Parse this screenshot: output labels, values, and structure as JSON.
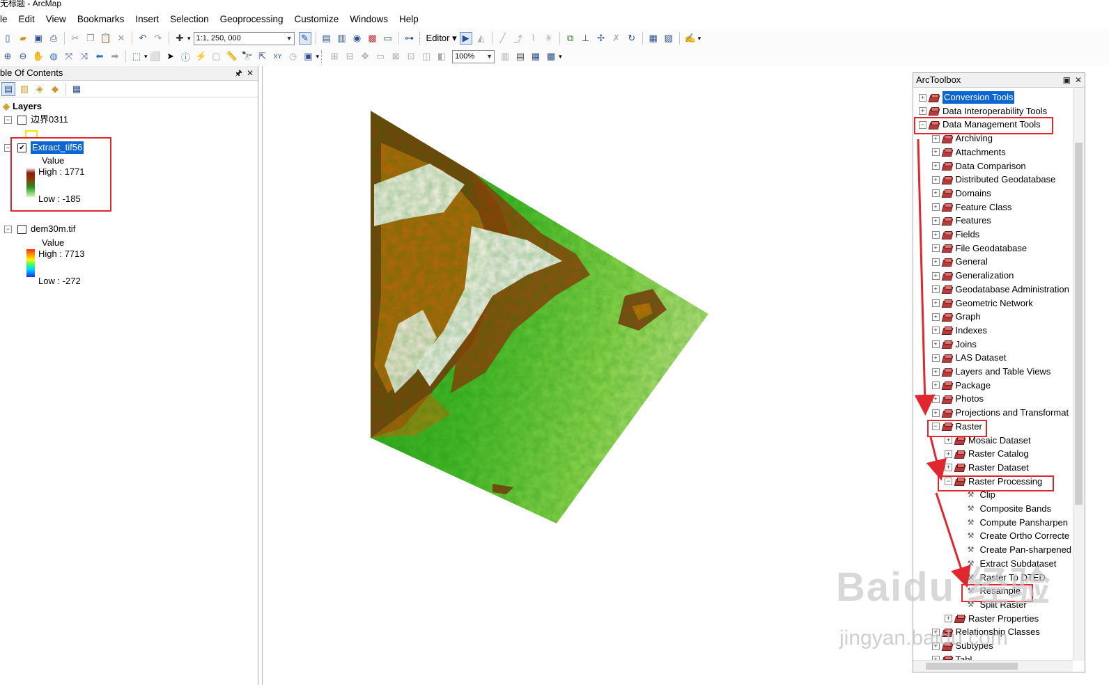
{
  "window": {
    "title": "无标题 - ArcMap"
  },
  "menu": [
    "le",
    "Edit",
    "View",
    "Bookmarks",
    "Insert",
    "Selection",
    "Geoprocessing",
    "Customize",
    "Windows",
    "Help"
  ],
  "toolbar": {
    "scale": "1:1, 250, 000",
    "editor_label": "Editor",
    "zoom": "100%"
  },
  "toc": {
    "title": "ble Of Contents",
    "pin": "◉",
    "close": "✕",
    "layers_label": "Layers",
    "layers": [
      {
        "name": "边界0311",
        "checked": false,
        "expander": "−"
      },
      {
        "name": "Extract_tif56",
        "checked": true,
        "expander": "−",
        "value_label": "Value",
        "high": "High : 1771",
        "low": "Low : -185"
      },
      {
        "name": "dem30m.tif",
        "checked": false,
        "expander": "−",
        "value_label": "Value",
        "high": "High : 7713",
        "low": "Low : -272"
      }
    ]
  },
  "arctoolbox": {
    "title": "ArcToolbox",
    "items": [
      {
        "label": "Conversion Tools",
        "level": 0,
        "expander": "+",
        "kind": "toolbox",
        "selected": true
      },
      {
        "label": "Data Interoperability Tools",
        "level": 0,
        "expander": "+",
        "kind": "toolbox"
      },
      {
        "label": "Data Management Tools",
        "level": 0,
        "expander": "−",
        "kind": "toolbox"
      },
      {
        "label": "Archiving",
        "level": 1,
        "expander": "+",
        "kind": "toolbox"
      },
      {
        "label": "Attachments",
        "level": 1,
        "expander": "+",
        "kind": "toolbox"
      },
      {
        "label": "Data Comparison",
        "level": 1,
        "expander": "+",
        "kind": "toolbox"
      },
      {
        "label": "Distributed Geodatabase",
        "level": 1,
        "expander": "+",
        "kind": "toolbox"
      },
      {
        "label": "Domains",
        "level": 1,
        "expander": "+",
        "kind": "toolbox"
      },
      {
        "label": "Feature Class",
        "level": 1,
        "expander": "+",
        "kind": "toolbox"
      },
      {
        "label": "Features",
        "level": 1,
        "expander": "+",
        "kind": "toolbox"
      },
      {
        "label": "Fields",
        "level": 1,
        "expander": "+",
        "kind": "toolbox"
      },
      {
        "label": "File Geodatabase",
        "level": 1,
        "expander": "+",
        "kind": "toolbox"
      },
      {
        "label": "General",
        "level": 1,
        "expander": "+",
        "kind": "toolbox"
      },
      {
        "label": "Generalization",
        "level": 1,
        "expander": "+",
        "kind": "toolbox"
      },
      {
        "label": "Geodatabase Administration",
        "level": 1,
        "expander": "+",
        "kind": "toolbox"
      },
      {
        "label": "Geometric Network",
        "level": 1,
        "expander": "+",
        "kind": "toolbox"
      },
      {
        "label": "Graph",
        "level": 1,
        "expander": "+",
        "kind": "toolbox"
      },
      {
        "label": "Indexes",
        "level": 1,
        "expander": "+",
        "kind": "toolbox"
      },
      {
        "label": "Joins",
        "level": 1,
        "expander": "+",
        "kind": "toolbox"
      },
      {
        "label": "LAS Dataset",
        "level": 1,
        "expander": "+",
        "kind": "toolbox"
      },
      {
        "label": "Layers and Table Views",
        "level": 1,
        "expander": "+",
        "kind": "toolbox"
      },
      {
        "label": "Package",
        "level": 1,
        "expander": "+",
        "kind": "toolbox"
      },
      {
        "label": "Photos",
        "level": 1,
        "expander": "+",
        "kind": "toolbox"
      },
      {
        "label": "Projections and Transformat",
        "level": 1,
        "expander": "+",
        "kind": "toolbox"
      },
      {
        "label": "Raster",
        "level": 1,
        "expander": "−",
        "kind": "toolbox"
      },
      {
        "label": "Mosaic Dataset",
        "level": 2,
        "expander": "+",
        "kind": "toolbox"
      },
      {
        "label": "Raster Catalog",
        "level": 2,
        "expander": "+",
        "kind": "toolbox"
      },
      {
        "label": "Raster Dataset",
        "level": 2,
        "expander": "+",
        "kind": "toolbox"
      },
      {
        "label": "Raster Processing",
        "level": 2,
        "expander": "−",
        "kind": "toolbox"
      },
      {
        "label": "Clip",
        "level": 3,
        "expander": "",
        "kind": "tool"
      },
      {
        "label": "Composite Bands",
        "level": 3,
        "expander": "",
        "kind": "tool"
      },
      {
        "label": "Compute Pansharpen",
        "level": 3,
        "expander": "",
        "kind": "tool"
      },
      {
        "label": "Create Ortho Correcte",
        "level": 3,
        "expander": "",
        "kind": "tool"
      },
      {
        "label": "Create Pan-sharpened",
        "level": 3,
        "expander": "",
        "kind": "tool"
      },
      {
        "label": "Extract Subdataset",
        "level": 3,
        "expander": "",
        "kind": "tool"
      },
      {
        "label": "Raster To DTED",
        "level": 3,
        "expander": "",
        "kind": "tool"
      },
      {
        "label": "Resample",
        "level": 3,
        "expander": "",
        "kind": "tool"
      },
      {
        "label": "Split Raster",
        "level": 3,
        "expander": "",
        "kind": "tool"
      },
      {
        "label": "Raster Properties",
        "level": 2,
        "expander": "+",
        "kind": "toolbox"
      },
      {
        "label": "Relationship Classes",
        "level": 1,
        "expander": "+",
        "kind": "toolbox"
      },
      {
        "label": "Subtypes",
        "level": 1,
        "expander": "+",
        "kind": "toolbox"
      },
      {
        "label": "Tabl",
        "level": 1,
        "expander": "+",
        "kind": "toolbox"
      }
    ]
  },
  "watermark": {
    "brand": "Baidu 经验",
    "url": "jingyan.baidu.com"
  },
  "colors": {
    "highlight": "#0b66d2",
    "annotation_red": "#e0262f"
  }
}
